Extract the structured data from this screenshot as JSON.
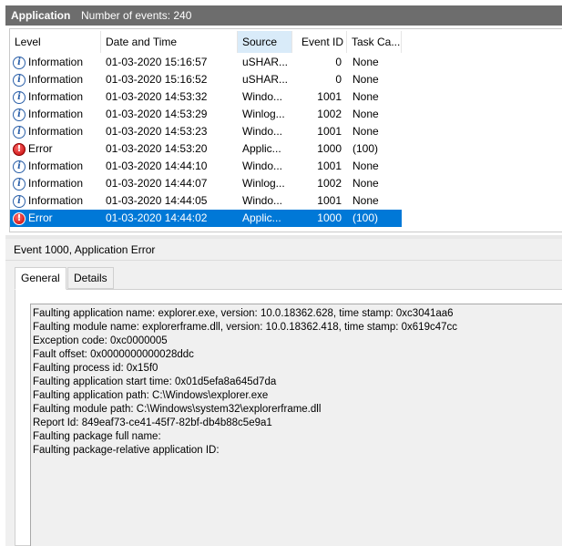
{
  "titlebar": {
    "log_name": "Application",
    "event_count": "Number of events: 240"
  },
  "columns": [
    "Level",
    "Date and Time",
    "Source",
    "Event ID",
    "Task Ca..."
  ],
  "sorted_column_index": 2,
  "events": [
    {
      "level": "Information",
      "icon": "information-icon",
      "date": "01-03-2020 15:16:57",
      "source": "uSHAR...",
      "id": "0",
      "task": "None"
    },
    {
      "level": "Information",
      "icon": "information-icon",
      "date": "01-03-2020 15:16:52",
      "source": "uSHAR...",
      "id": "0",
      "task": "None"
    },
    {
      "level": "Information",
      "icon": "information-icon",
      "date": "01-03-2020 14:53:32",
      "source": "Windo...",
      "id": "1001",
      "task": "None"
    },
    {
      "level": "Information",
      "icon": "information-icon",
      "date": "01-03-2020 14:53:29",
      "source": "Winlog...",
      "id": "1002",
      "task": "None"
    },
    {
      "level": "Information",
      "icon": "information-icon",
      "date": "01-03-2020 14:53:23",
      "source": "Windo...",
      "id": "1001",
      "task": "None"
    },
    {
      "level": "Error",
      "icon": "error-icon",
      "date": "01-03-2020 14:53:20",
      "source": "Applic...",
      "id": "1000",
      "task": "(100)"
    },
    {
      "level": "Information",
      "icon": "information-icon",
      "date": "01-03-2020 14:44:10",
      "source": "Windo...",
      "id": "1001",
      "task": "None"
    },
    {
      "level": "Information",
      "icon": "information-icon",
      "date": "01-03-2020 14:44:07",
      "source": "Winlog...",
      "id": "1002",
      "task": "None"
    },
    {
      "level": "Information",
      "icon": "information-icon",
      "date": "01-03-2020 14:44:05",
      "source": "Windo...",
      "id": "1001",
      "task": "None"
    },
    {
      "level": "Error",
      "icon": "error-icon",
      "date": "01-03-2020 14:44:02",
      "source": "Applic...",
      "id": "1000",
      "task": "(100)",
      "selected": true
    }
  ],
  "detail": {
    "title": "Event 1000, Application Error",
    "tabs": [
      "General",
      "Details"
    ],
    "active_tab": 0,
    "description_lines": [
      "Faulting application name: explorer.exe, version: 10.0.18362.628, time stamp: 0xc3041aa6",
      "Faulting module name: explorerframe.dll, version: 10.0.18362.418, time stamp: 0x619c47cc",
      "Exception code: 0xc0000005",
      "Fault offset: 0x0000000000028ddc",
      "Faulting process id: 0x15f0",
      "Faulting application start time: 0x01d5efa8a645d7da",
      "Faulting application path: C:\\Windows\\explorer.exe",
      "Faulting module path: C:\\Windows\\system32\\explorerframe.dll",
      "Report Id: 849eaf73-ce41-45f7-82bf-db4b88c5e9a1",
      "Faulting package full name:",
      "Faulting package-relative application ID:"
    ]
  },
  "colors": {
    "selection": "#0078d7",
    "titlebar": "#6d6d6d",
    "sorted_header": "#d9ebf9"
  }
}
